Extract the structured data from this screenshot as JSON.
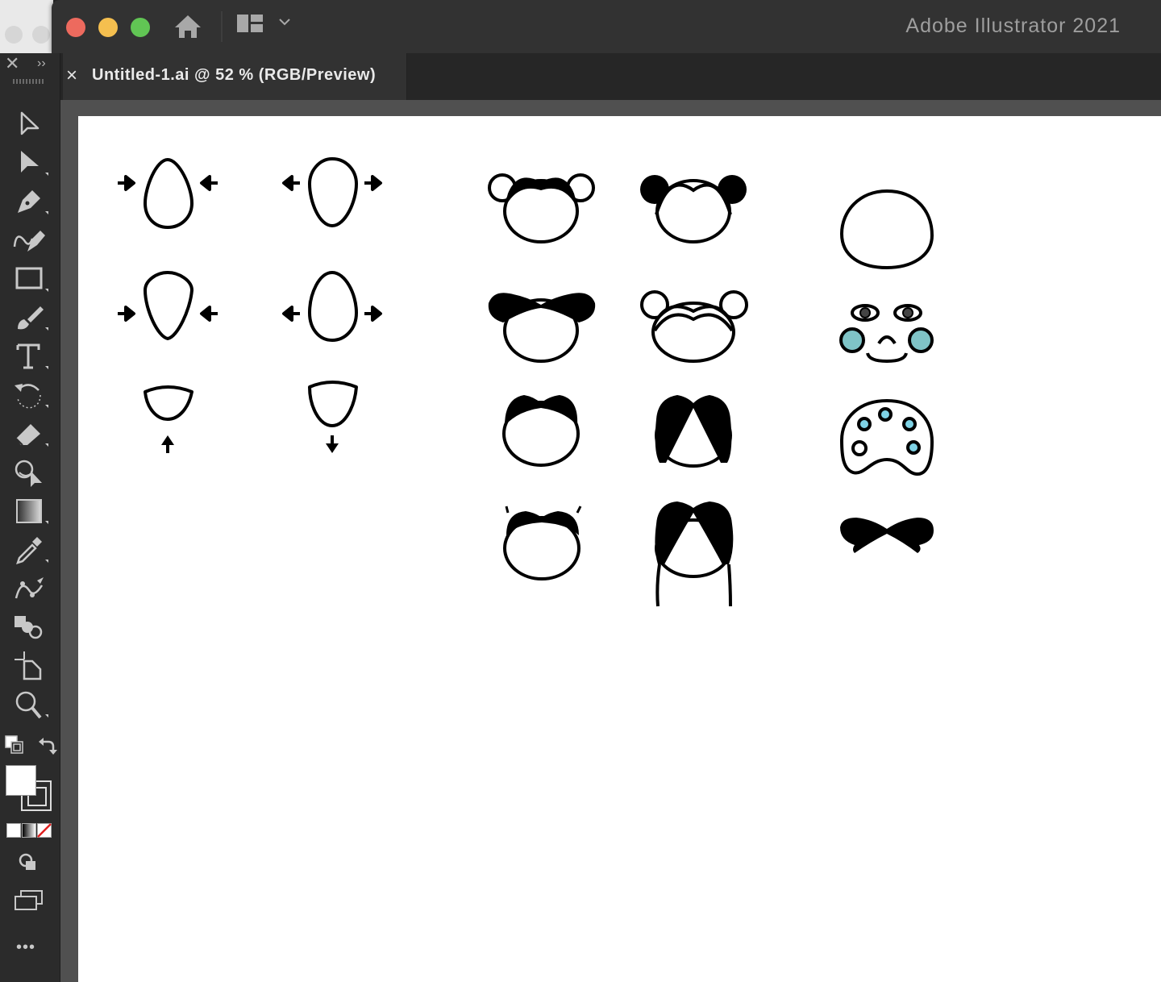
{
  "window": {
    "app_title": "Adobe Illustrator 2021",
    "traffic_lights": {
      "close": "#ed6a5e",
      "minimize": "#f5bf4f",
      "maximize": "#61c554"
    }
  },
  "titlebar": {
    "home_icon": "home-icon",
    "workspace_icon": "workspace-switcher-icon",
    "workspace_chevron": "chevron-down-icon"
  },
  "document_tab": {
    "close_label": "×",
    "title": "Untitled-1.ai @ 52 % (RGB/Preview)"
  },
  "toolbar": {
    "close_label": "✕",
    "expand_label": "››",
    "tools": [
      {
        "name": "selection-tool",
        "icon": "arrow-icon"
      },
      {
        "name": "direct-selection-tool",
        "icon": "direct-arrow-icon"
      },
      {
        "name": "pen-tool",
        "icon": "pen-icon"
      },
      {
        "name": "curvature-tool",
        "icon": "curvature-icon"
      },
      {
        "name": "rectangle-tool",
        "icon": "rectangle-icon"
      },
      {
        "name": "paintbrush-tool",
        "icon": "brush-icon"
      },
      {
        "name": "type-tool",
        "icon": "type-icon"
      },
      {
        "name": "rotate-tool",
        "icon": "rotate-icon"
      },
      {
        "name": "eraser-tool",
        "icon": "eraser-icon"
      },
      {
        "name": "shape-builder-tool",
        "icon": "shape-builder-icon"
      },
      {
        "name": "gradient-tool",
        "icon": "gradient-icon"
      },
      {
        "name": "eyedropper-tool",
        "icon": "eyedropper-icon"
      },
      {
        "name": "puppet-warp-tool",
        "icon": "puppet-warp-icon"
      },
      {
        "name": "blend-tool",
        "icon": "blend-icon"
      },
      {
        "name": "artboard-tool",
        "icon": "artboard-icon"
      },
      {
        "name": "zoom-tool",
        "icon": "zoom-icon"
      }
    ],
    "fill_color": "#ffffff",
    "stroke_color": "#000000",
    "more_label": "•••"
  },
  "artboard": {
    "background": "#ffffff",
    "accent_fill": "#7fc4c7",
    "dot_fill": "#7fd3e6"
  }
}
